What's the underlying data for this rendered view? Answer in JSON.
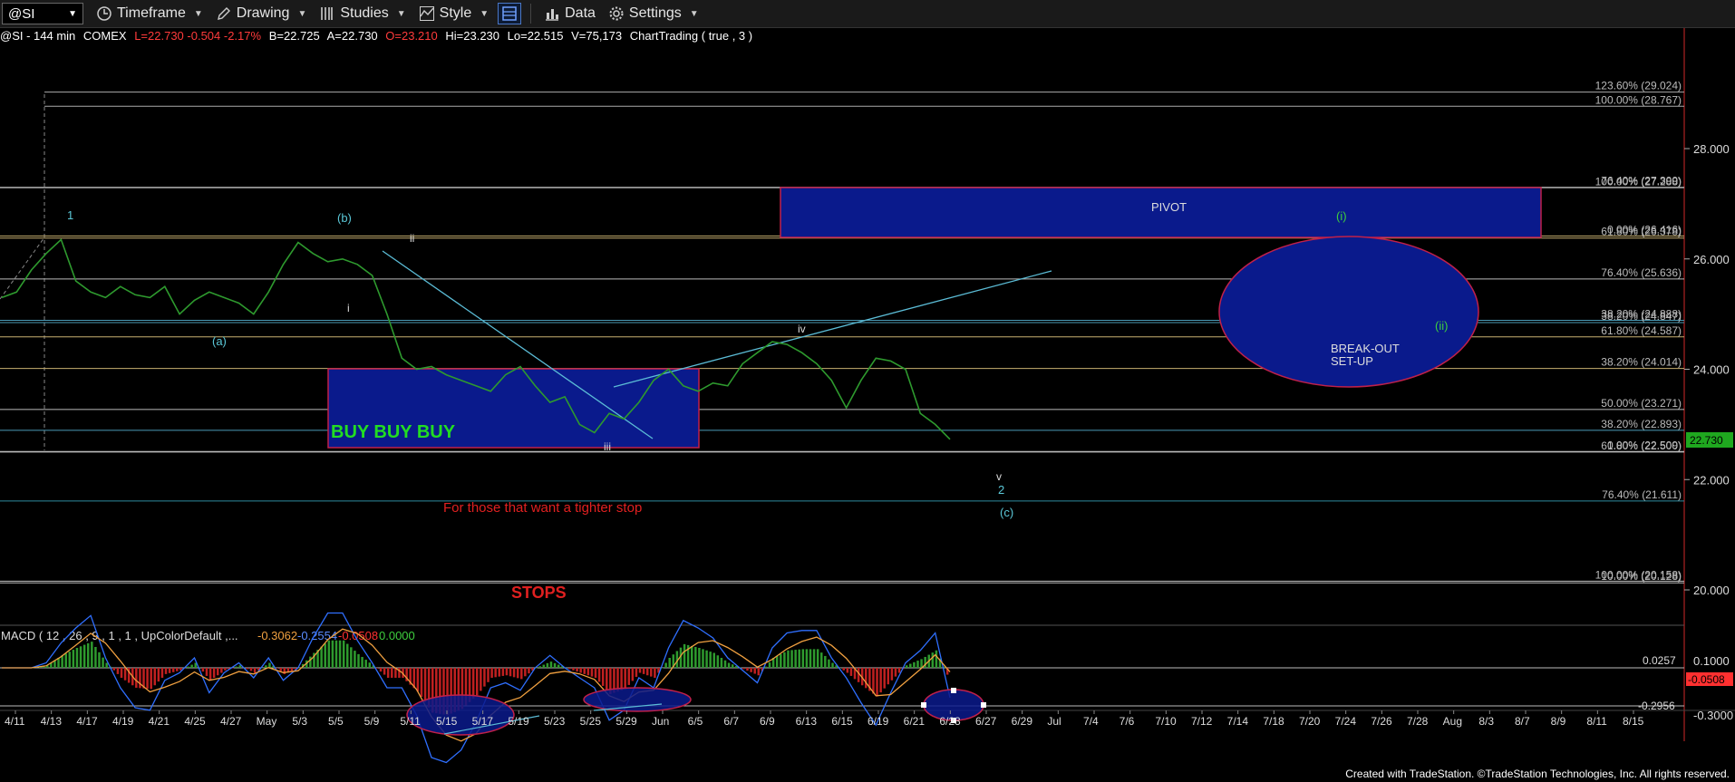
{
  "toolbar": {
    "symbol": "@SI",
    "timeframe_label": "Timeframe",
    "drawing_label": "Drawing",
    "studies_label": "Studies",
    "style_label": "Style",
    "data_label": "Data",
    "settings_label": "Settings"
  },
  "infobar": {
    "symbol": "@SI - 144 min",
    "exchange": "COMEX",
    "last_change": "L=22.730  -0.504  -2.17%",
    "bid": "B=22.725",
    "ask": "A=22.730",
    "open": "O=23.210",
    "high": "Hi=23.230",
    "low": "Lo=22.515",
    "volume": "V=75,173",
    "study": "ChartTrading ( true , 3 )"
  },
  "colors": {
    "up_green": "#2e9a2e",
    "cyan_line": "#5bbcd6",
    "box_blue": "#0a1a8c",
    "box_border": "#c0204a",
    "red_text": "#e02020",
    "price_tag": "#1fa81f",
    "macd_red": "#ff3030",
    "macd_blue": "#2f6fff",
    "macd_orange": "#f0a040",
    "wave_label": "#5bc8d8",
    "fib_text": "#bbbbbb"
  },
  "chart_data": {
    "type": "line",
    "title": "",
    "price_axis": {
      "ylim": [
        19.7,
        29.4
      ],
      "ticks": [
        "28.000",
        "26.000",
        "24.000",
        "22.000",
        "20.000"
      ]
    },
    "current_price_tag": "22.730",
    "x_tick_labels": [
      "4/11",
      "4/13",
      "4/17",
      "4/19",
      "4/21",
      "4/25",
      "4/27",
      "May",
      "5/3",
      "5/5",
      "5/9",
      "5/11",
      "5/15",
      "5/17",
      "5/19",
      "5/23",
      "5/25",
      "5/29",
      "Jun",
      "6/5",
      "6/7",
      "6/9",
      "6/13",
      "6/15",
      "6/19",
      "6/21",
      "6/23",
      "6/27",
      "6/29",
      "Jul",
      "7/4",
      "7/6",
      "7/10",
      "7/12",
      "7/14",
      "7/18",
      "7/20",
      "7/24",
      "7/26",
      "7/28",
      "Aug",
      "8/3",
      "8/7",
      "8/9",
      "8/11",
      "8/15"
    ],
    "series": [
      {
        "x": [
          0,
          4,
          8,
          12,
          16,
          20,
          24,
          28,
          32,
          36,
          40,
          44,
          48,
          52,
          56,
          60,
          64,
          68,
          72,
          76,
          80,
          84,
          88,
          92,
          96,
          100,
          104,
          108,
          112,
          116,
          120,
          124,
          128,
          132,
          136,
          140,
          144,
          148,
          152,
          156,
          160,
          164,
          168,
          172,
          176,
          180,
          184,
          188,
          192,
          196,
          200,
          204,
          208,
          212,
          216,
          220,
          224,
          228,
          232,
          236,
          240,
          244,
          248,
          252,
          256
        ],
        "y": [
          25.3,
          25.4,
          25.8,
          26.1,
          26.35,
          25.6,
          25.4,
          25.3,
          25.5,
          25.35,
          25.3,
          25.5,
          25.0,
          25.25,
          25.4,
          25.3,
          25.2,
          25.0,
          25.4,
          25.9,
          26.3,
          26.1,
          25.95,
          26.0,
          25.9,
          25.7,
          25.0,
          24.2,
          24.0,
          24.05,
          23.9,
          23.8,
          23.7,
          23.6,
          23.9,
          24.05,
          23.7,
          23.4,
          23.5,
          23.0,
          22.85,
          23.2,
          23.1,
          23.4,
          23.8,
          24.0,
          23.7,
          23.6,
          23.75,
          23.7,
          24.1,
          24.3,
          24.5,
          24.45,
          24.3,
          24.1,
          23.8,
          23.3,
          23.8,
          24.2,
          24.15,
          24.0,
          23.2,
          23.0,
          22.73
        ]
      }
    ],
    "fib_labels": [
      "123.60% (29.024)",
      "100.00% (28.767)",
      "100.00% (27.288)",
      "76.40% (27.300)",
      "0.00% (26.416)",
      "61.80% (26.378)",
      "76.40% (25.636)",
      "38.20% (24.888)",
      "38.20% (24.847)",
      "61.80% (24.587)",
      "38.20% (24.014)",
      "50.00% (23.271)",
      "38.20% (22.893)",
      "0.00% (22.509)",
      "61.80% (22.500)",
      "76.40% (21.611)",
      "100.00% (20.158)",
      "10.00% (20.128)"
    ],
    "annotations": {
      "pivot": "PIVOT",
      "breakout": [
        "BREAK-OUT",
        "SET-UP"
      ],
      "buy": "BUY BUY BUY",
      "tighter_stop": "For those that want a tighter stop",
      "stops": "STOPS",
      "waves": [
        "1",
        "(b)",
        "ii",
        "i",
        "(a)",
        "iii",
        "iv",
        "v",
        "2",
        "(c)",
        "(i)",
        "(ii)"
      ]
    },
    "macd": {
      "label": "MACD ( 12 , 26 , 9 , 1 , 1 , UpColorDefault ,...",
      "values": [
        "-0.3062",
        "-0.2554",
        "-0.0508",
        "0.0000"
      ],
      "ticks": [
        "0.1000",
        "-0.3000"
      ],
      "level_labels": [
        "0.0257",
        "-0.2956"
      ],
      "current_tag": "-0.0508"
    }
  },
  "footer": {
    "credit": "Created with TradeStation. ©TradeStation Technologies, Inc. All rights reserved."
  }
}
